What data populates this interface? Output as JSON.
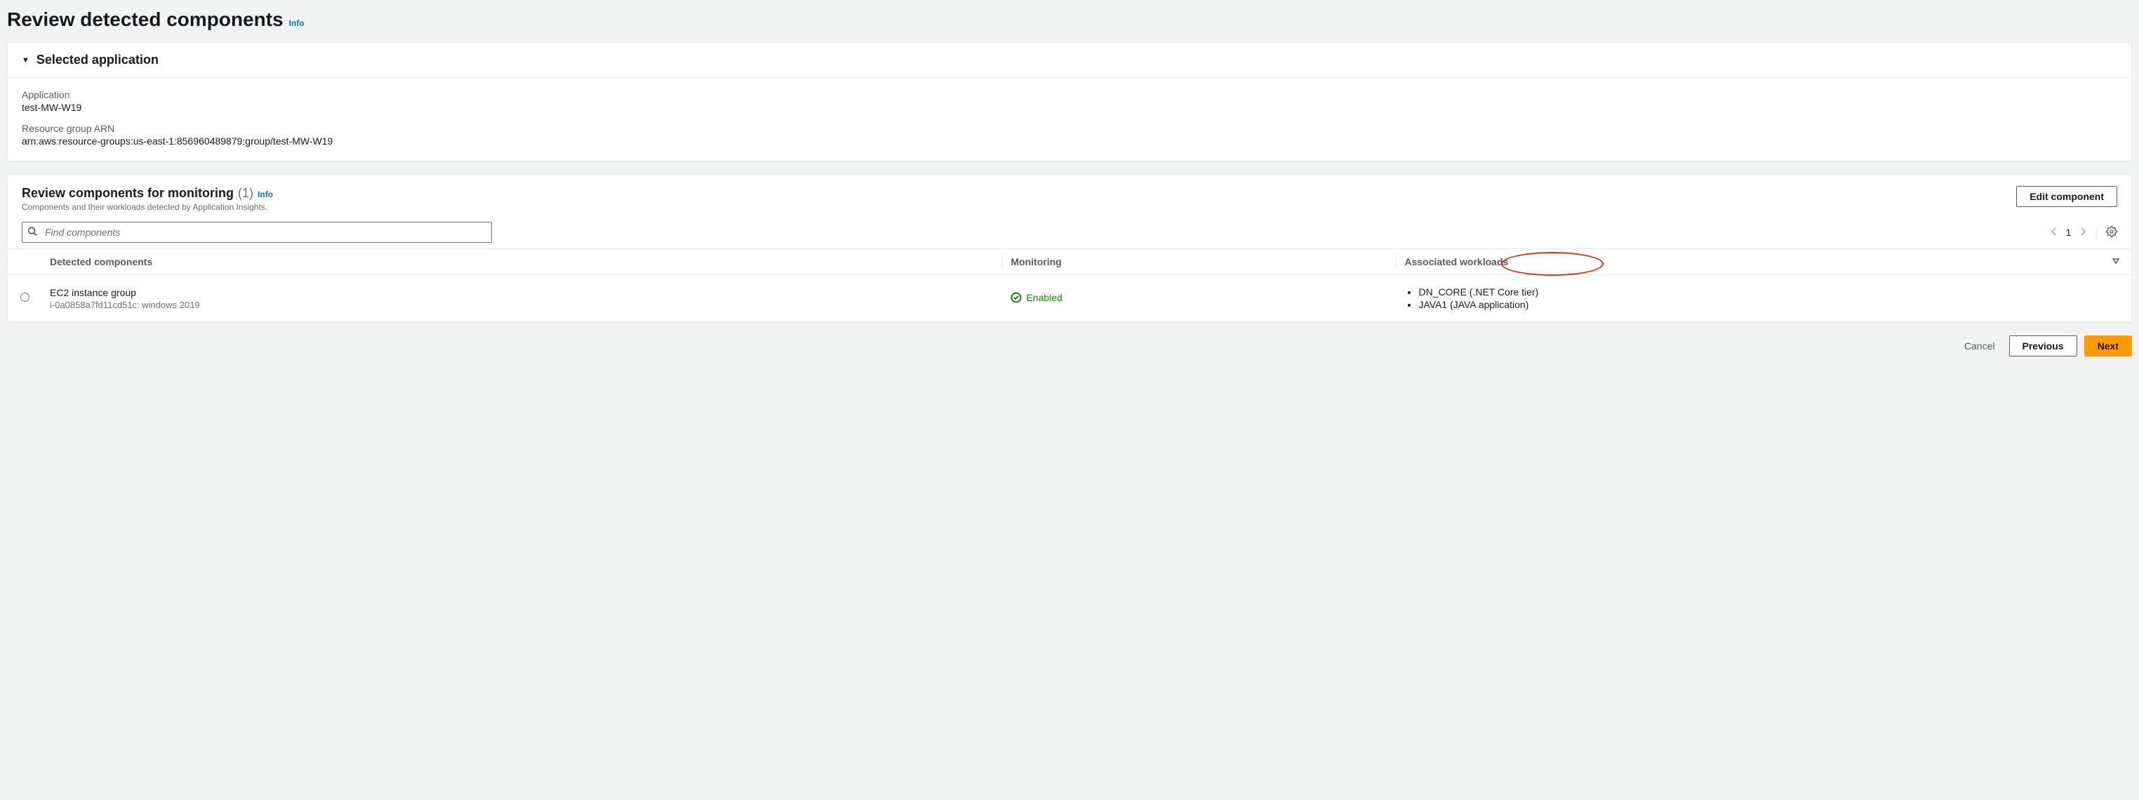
{
  "page": {
    "title": "Review detected components",
    "info": "Info"
  },
  "selected_app": {
    "header": "Selected application",
    "application_label": "Application",
    "application_value": "test-MW-W19",
    "rg_arn_label": "Resource group ARN",
    "rg_arn_value": "arn:aws:resource-groups:us-east-1:856960489879:group/test-MW-W19"
  },
  "review": {
    "title": "Review components for monitoring",
    "count": "(1)",
    "info": "Info",
    "desc": "Components and their workloads detected by Application Insights.",
    "edit_btn": "Edit component",
    "search_placeholder": "Find components",
    "page_num": "1",
    "columns": {
      "detected": "Detected components",
      "monitoring": "Monitoring",
      "workloads": "Associated workloads"
    },
    "rows": [
      {
        "name": "EC2 instance group",
        "sub": "i-0a0858a7fd11cd51c: windows 2019",
        "monitoring": "Enabled",
        "workloads": [
          "DN_CORE (.NET Core tier)",
          "JAVA1 (JAVA application)"
        ]
      }
    ]
  },
  "footer": {
    "cancel": "Cancel",
    "previous": "Previous",
    "next": "Next"
  }
}
